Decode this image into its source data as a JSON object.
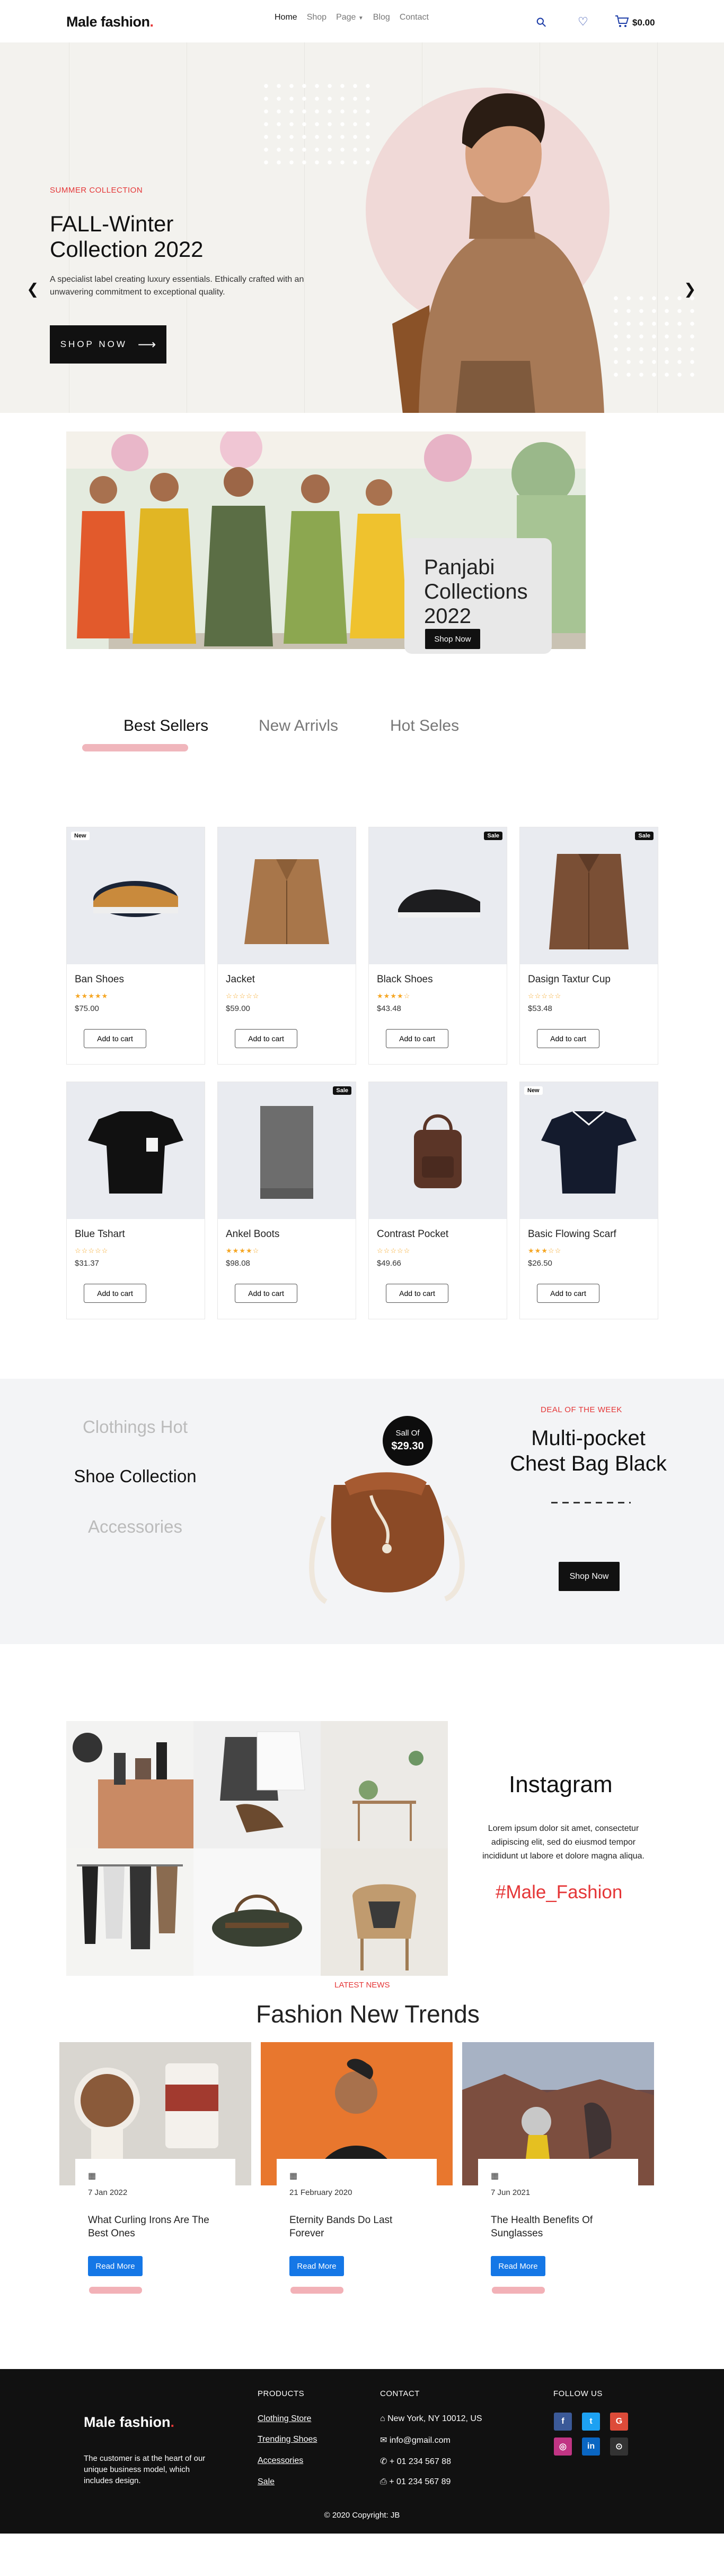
{
  "header": {
    "logo_main": "Male fashion",
    "logo_dot": ".",
    "nav": {
      "home": "Home",
      "shop": "Shop",
      "page": "Page",
      "blog": "Blog",
      "contact": "Contact"
    },
    "cart_total": "$0.00",
    "icons": [
      "search-icon",
      "heart-icon",
      "cart-icon"
    ]
  },
  "hero": {
    "subtitle": "SUMMER COLLECTION",
    "title_line1": "FALL-Winter",
    "title_line2": "Collection 2022",
    "description": "A specialist label creating luxury essentials. Ethically crafted with an unwavering commitment to exceptional quality.",
    "button": "SHOP NOW",
    "social_icons": [
      "facebook-icon",
      "twitter-icon",
      "instagram-icon",
      "linkedin-icon"
    ]
  },
  "panjabi": {
    "title": "Panjabi Collections 2022",
    "button": "Shop Now"
  },
  "tabs": {
    "best": "Best Sellers",
    "new": "New Arrivls",
    "hot": "Hot Seles"
  },
  "products": [
    {
      "name": "Ban Shoes",
      "price": "$75.00",
      "rating": 5,
      "badge": "New",
      "add": "Add to cart"
    },
    {
      "name": "Jacket",
      "price": "$59.00",
      "rating": 0,
      "badge": "",
      "add": "Add to cart"
    },
    {
      "name": "Black Shoes",
      "price": "$43.48",
      "rating": 4,
      "badge": "Sale",
      "add": "Add to cart"
    },
    {
      "name": "Dasign Taxtur Cup",
      "price": "$53.48",
      "rating": 0,
      "badge": "Sale",
      "add": "Add to cart"
    },
    {
      "name": "Blue Tshart",
      "price": "$31.37",
      "rating": 0,
      "badge": "",
      "add": "Add to cart"
    },
    {
      "name": "Ankel Boots",
      "price": "$98.08",
      "rating": 4,
      "badge": "Sale",
      "add": "Add to cart"
    },
    {
      "name": "Contrast Pocket",
      "price": "$49.66",
      "rating": 0,
      "badge": "",
      "add": "Add to cart"
    },
    {
      "name": "Basic Flowing Scarf",
      "price": "$26.50",
      "rating": 3,
      "badge": "New",
      "add": "Add to cart"
    }
  ],
  "deal": {
    "categories": [
      "Clothings Hot",
      "Shoe Collection",
      "Accessories"
    ],
    "sale_label": "Sall Of",
    "sale_price": "$29.30",
    "kicker": "DEAL OF THE WEEK",
    "title": "Multi-pocket Chest Bag Black",
    "button": "Shop Now"
  },
  "instagram": {
    "title": "Instagram",
    "text": "Lorem ipsum dolor sit amet, consectetur adipiscing elit, sed do eiusmod tempor incididunt ut labore et dolore magna aliqua.",
    "hashtag": "#Male_Fashion"
  },
  "blog": {
    "kicker": "LATEST NEWS",
    "title": "Fashion New Trends",
    "posts": [
      {
        "date": "7 Jan 2022",
        "title": "What Curling Irons Are The Best Ones",
        "button": "Read More"
      },
      {
        "date": "21 February 2020",
        "title": "Eternity Bands Do Last Forever",
        "button": "Read More"
      },
      {
        "date": "7 Jun 2021",
        "title": "The Health Benefits Of Sunglasses",
        "button": "Read More"
      }
    ]
  },
  "footer": {
    "logo_main": "Male fashion",
    "logo_dot": ".",
    "about": "The customer is at the heart of our unique business model, which includes design.",
    "products_heading": "PRODUCTS",
    "products": [
      "Clothing Store",
      "Trending Shoes",
      "Accessories",
      "Sale"
    ],
    "contact_heading": "CONTACT",
    "contact": [
      "New York, NY 10012, US",
      "info@gmail.com",
      "+ 01 234 567 88",
      "+ 01 234 567 89"
    ],
    "follow_heading": "FOLLOW US",
    "copyright": "© 2020 Copyright: JB",
    "colors": {
      "facebook": "#3b5998",
      "twitter": "#1da1f2",
      "google": "#dd4b39",
      "instagram": "#c13584",
      "linkedin": "#0a66c2",
      "github": "#333333"
    }
  },
  "colors": {
    "accent": "#e53637",
    "dark": "#111111",
    "blue": "#1577e6",
    "pink": "#f2b1b7"
  }
}
